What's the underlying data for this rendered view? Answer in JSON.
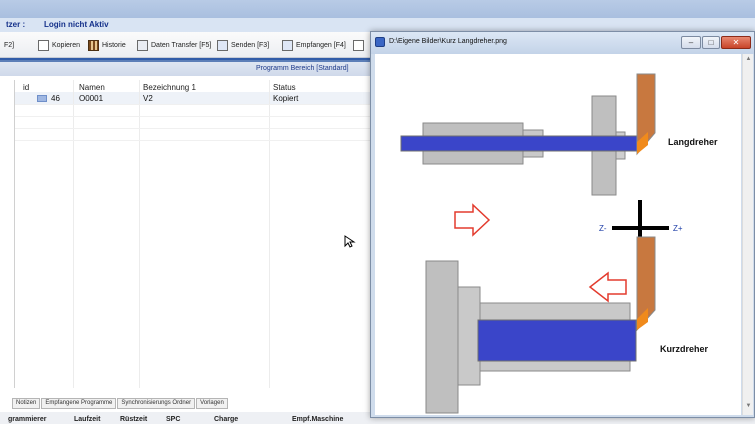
{
  "user": {
    "label": "tzer :",
    "status": "Login nicht Aktiv"
  },
  "toolbar": {
    "f2_label": "F2]",
    "copy_label": "Kopieren",
    "history_label": "Historie",
    "transfer_label": "Daten Transfer [F5]",
    "send_label": "Senden [F3]",
    "receive_label": "Empfangen [F4]"
  },
  "program_range": "Programm Bereich [Standard]",
  "table": {
    "columns": [
      "id",
      "Namen",
      "Bezeichnung 1",
      "Status"
    ],
    "rows": [
      {
        "id": "46",
        "name": "O0001",
        "bezeichnung": "V2",
        "status": "Kopiert"
      }
    ]
  },
  "bottom_tabs": [
    "Notizen",
    "Empfangene Programme",
    "Synchronisierungs Ordner",
    "Vorlagen"
  ],
  "footer_columns": [
    "grammierer",
    "Laufzeit",
    "Rüstzeit",
    "SPC",
    "Charge",
    "Empf.Maschine"
  ],
  "viewer": {
    "title": "D:\\Eigene Bilder\\Kurz Langdreher.png",
    "labels": {
      "langdreher": "Langdreher",
      "kurzdreher": "Kurzdreher",
      "z_minus": "Z-",
      "z_plus": "Z+"
    },
    "colors": {
      "workpiece": "#3a45c9",
      "tool": "#c8783f",
      "tool_tip": "#f08a1c",
      "arrow": "#e33b2e",
      "body": "#bfbfbf",
      "axis_label": "#1f3fa8"
    }
  }
}
